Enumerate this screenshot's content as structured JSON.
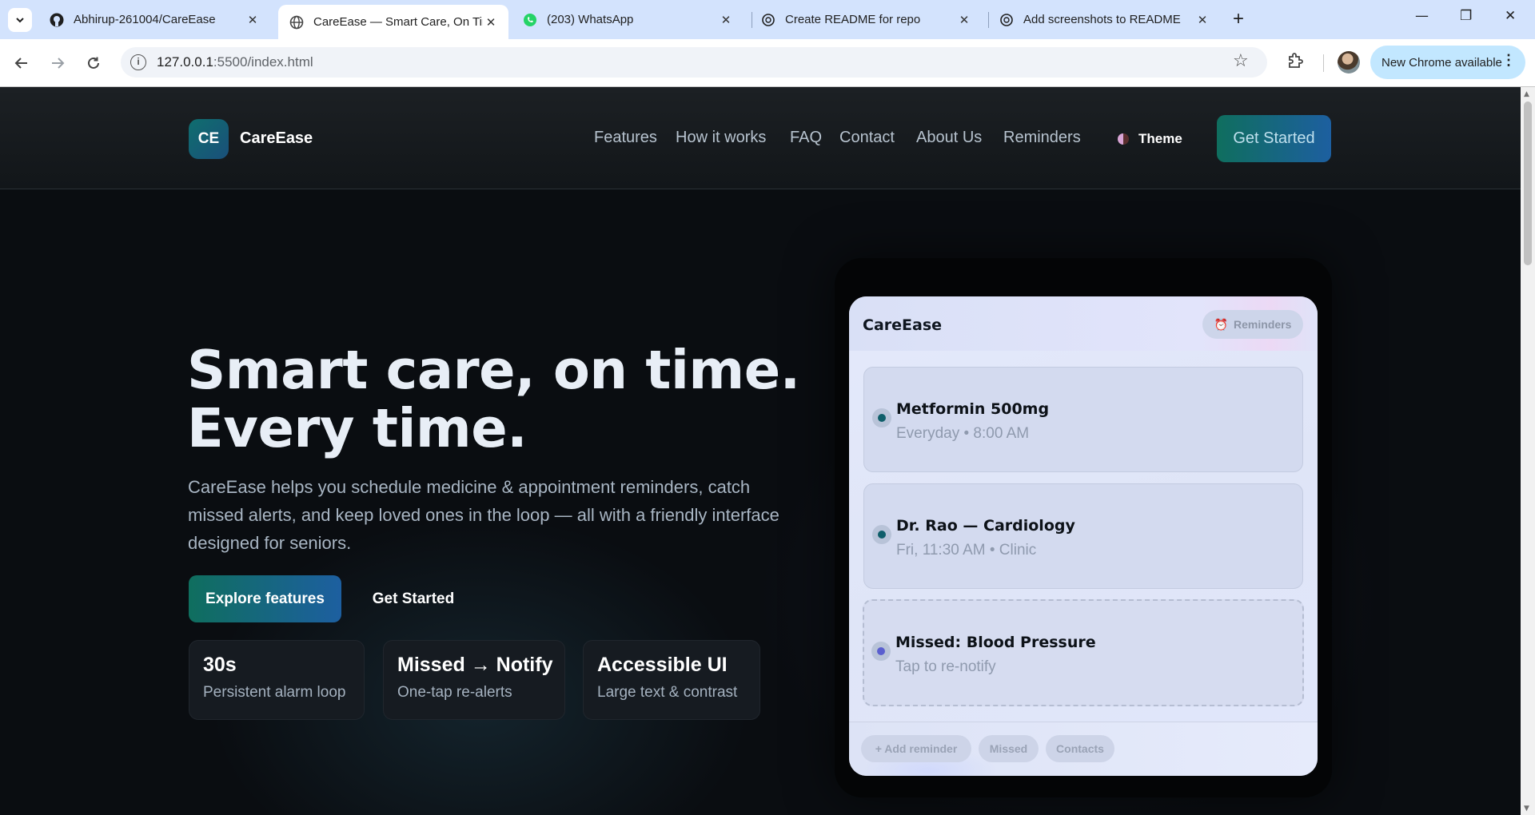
{
  "browser": {
    "tabs": [
      {
        "title": "Abhirup-261004/CareEase",
        "icon": "github-icon"
      },
      {
        "title": "CareEase — Smart Care, On Tim",
        "icon": "globe-icon"
      },
      {
        "title": "(203) WhatsApp",
        "icon": "whatsapp-icon"
      },
      {
        "title": "Create README for repo",
        "icon": "openai-icon"
      },
      {
        "title": "Add screenshots to README",
        "icon": "openai-icon"
      }
    ],
    "url_host": "127.0.0.1",
    "url_path": ":5500/index.html",
    "update_label": "New Chrome available",
    "active_tab_index": 1
  },
  "site": {
    "logo_badge": "CE",
    "logo_name": "CareEase",
    "nav": [
      "Features",
      "How it works",
      "FAQ",
      "Contact",
      "About Us",
      "Reminders"
    ],
    "theme_label": "Theme",
    "cta_label": "Get Started"
  },
  "hero": {
    "title_line1": "Smart care, on time.",
    "title_line2": "Every time.",
    "subtitle": "CareEase helps you schedule medicine & appointment reminders, catch missed alerts, and keep loved ones in the loop — all with a friendly interface designed for seniors.",
    "explore_label": "Explore features",
    "get_started_label": "Get Started",
    "stats": [
      {
        "value": "30s",
        "label": "Persistent alarm loop"
      },
      {
        "value": "Missed → Notify",
        "label": "One-tap re-alerts"
      },
      {
        "value": "Accessible UI",
        "label": "Large text & contrast"
      }
    ]
  },
  "mockup": {
    "app_title": "CareEase",
    "reminders_pill": "Reminders",
    "cards": [
      {
        "title": "Metformin 500mg",
        "sub": "Everyday • 8:00 AM",
        "status": "scheduled"
      },
      {
        "title": "Dr. Rao — Cardiology",
        "sub": "Fri, 11:30 AM • Clinic",
        "status": "scheduled"
      },
      {
        "title": "Missed: Blood Pressure",
        "sub": "Tap to re-notify",
        "status": "missed"
      }
    ],
    "chips": [
      "+ Add reminder",
      "Missed",
      "Contacts"
    ]
  }
}
